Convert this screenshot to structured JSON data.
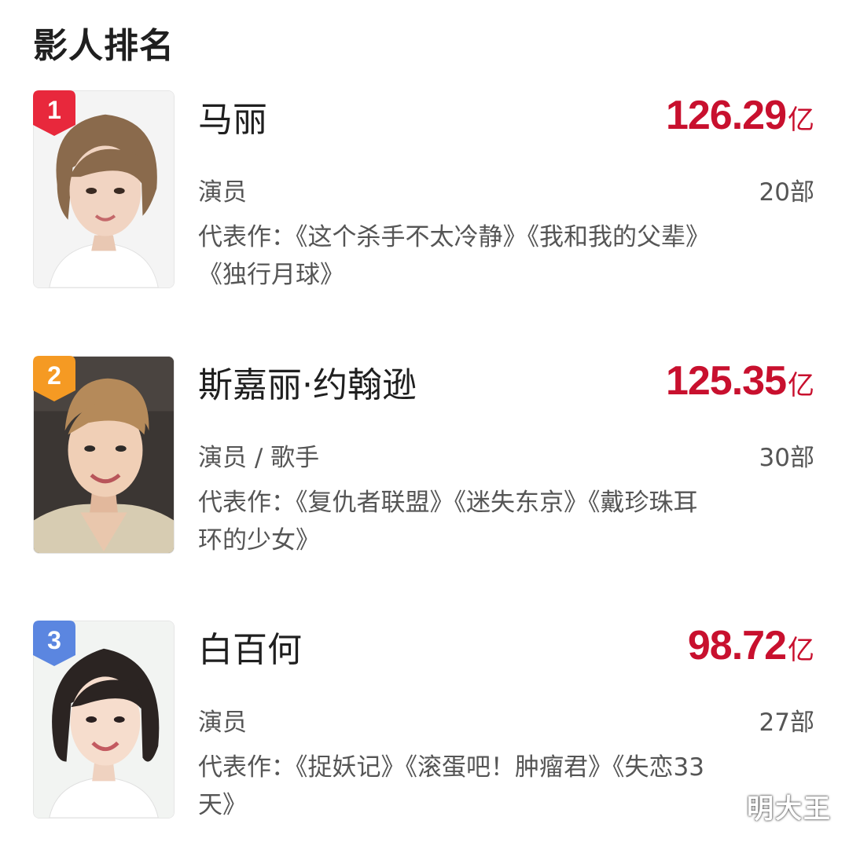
{
  "header": {
    "title": "影人排名"
  },
  "colors": {
    "accent_red": "#c8102e",
    "rank1_badge": "#e8283c",
    "rank2_badge": "#f59a23",
    "rank3_badge": "#5b86e0"
  },
  "rankings": [
    {
      "rank": "1",
      "name": "马丽",
      "box_office": "126.29",
      "unit": "亿",
      "role": "演员",
      "film_count": "20部",
      "works": "代表作：《这个杀手不太冷静》《我和我的父辈》《独行月球》",
      "badge_color_key": "rank1_badge"
    },
    {
      "rank": "2",
      "name": "斯嘉丽·约翰逊",
      "box_office": "125.35",
      "unit": "亿",
      "role": "演员 / 歌手",
      "film_count": "30部",
      "works": "代表作：《复仇者联盟》《迷失东京》《戴珍珠耳环的少女》",
      "badge_color_key": "rank2_badge"
    },
    {
      "rank": "3",
      "name": "白百何",
      "box_office": "98.72",
      "unit": "亿",
      "role": "演员",
      "film_count": "27部",
      "works": "代表作：《捉妖记》《滚蛋吧！肿瘤君》《失恋33天》",
      "badge_color_key": "rank3_badge"
    }
  ],
  "watermark": "明大王"
}
